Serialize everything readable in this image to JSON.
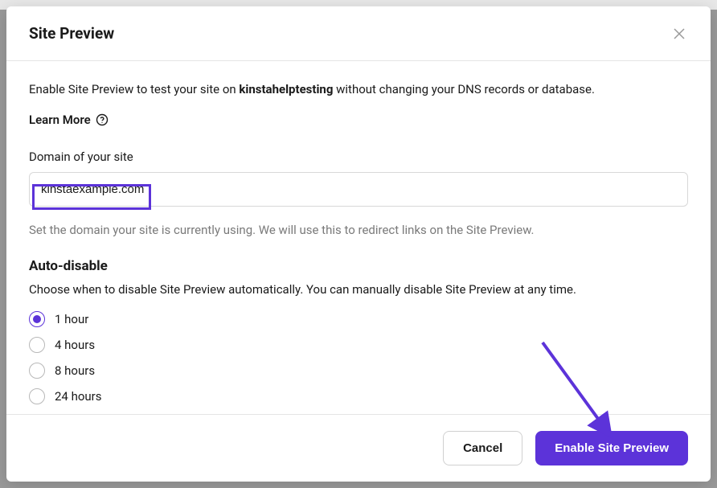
{
  "modal": {
    "title": "Site Preview",
    "description_prefix": "Enable Site Preview to test your site on ",
    "description_site": "kinstahelptesting",
    "description_suffix": " without changing your DNS records or database.",
    "learn_more_label": "Learn More",
    "domain_field": {
      "label": "Domain of your site",
      "value": "kinstaexample.com",
      "helper": "Set the domain your site is currently using. We will use this to redirect links on the Site Preview."
    },
    "auto_disable": {
      "title": "Auto-disable",
      "description": "Choose when to disable Site Preview automatically. You can manually disable Site Preview at any time.",
      "options": [
        {
          "label": "1 hour",
          "selected": true
        },
        {
          "label": "4 hours",
          "selected": false
        },
        {
          "label": "8 hours",
          "selected": false
        },
        {
          "label": "24 hours",
          "selected": false
        }
      ]
    },
    "footer": {
      "cancel_label": "Cancel",
      "submit_label": "Enable Site Preview"
    }
  },
  "colors": {
    "accent": "#5c33d9"
  }
}
